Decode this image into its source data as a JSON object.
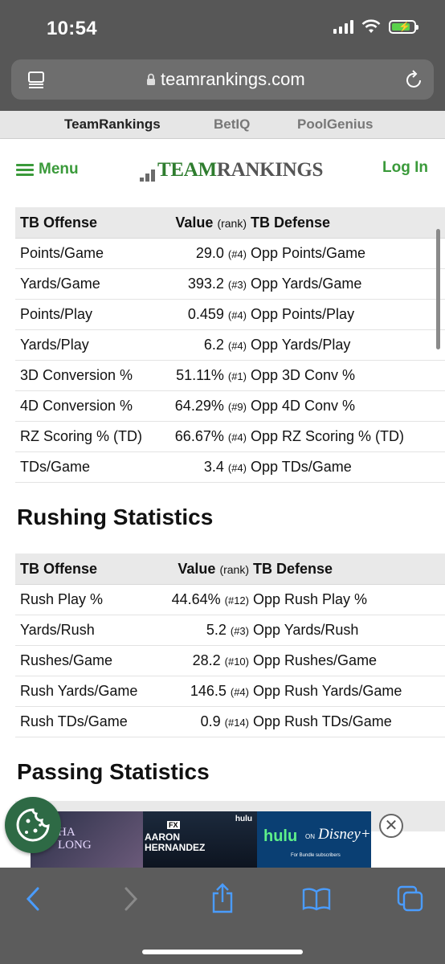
{
  "status": {
    "time": "10:54"
  },
  "browser": {
    "url": "teamrankings.com"
  },
  "site_nav": [
    "TeamRankings",
    "BetIQ",
    "PoolGenius"
  ],
  "header": {
    "menu_label": "Menu",
    "logo_part1": "TEAM",
    "logo_part2": "RANKINGS",
    "login_label": "Log In"
  },
  "offense_table": {
    "headers": {
      "col1": "TB Offense",
      "col2": "Value",
      "col2_suffix": "(rank)",
      "col3": "TB Defense"
    },
    "rows": [
      {
        "stat": "Points/Game",
        "value": "29.0",
        "rank": "(#4)",
        "opp": "Opp Points/Game",
        "extra": ""
      },
      {
        "stat": "Yards/Game",
        "value": "393.2",
        "rank": "(#3)",
        "opp": "Opp Yards/Game",
        "extra": ""
      },
      {
        "stat": "Points/Play",
        "value": "0.459",
        "rank": "(#4)",
        "opp": "Opp Points/Play",
        "extra": ""
      },
      {
        "stat": "Yards/Play",
        "value": "6.2",
        "rank": "(#4)",
        "opp": "Opp Yards/Play",
        "extra": ""
      },
      {
        "stat": "3D Conversion %",
        "value": "51.11%",
        "rank": "(#1)",
        "opp": "Opp 3D Conv %",
        "extra": ""
      },
      {
        "stat": "4D Conversion %",
        "value": "64.29%",
        "rank": "(#9)",
        "opp": "Opp 4D Conv %",
        "extra": ""
      },
      {
        "stat": "RZ Scoring % (TD)",
        "value": "66.67%",
        "rank": "(#4)",
        "opp": "Opp RZ Scoring % (TD)",
        "extra": ""
      },
      {
        "stat": "TDs/Game",
        "value": "3.4",
        "rank": "(#4)",
        "opp": "Opp TDs/Game",
        "extra": ""
      }
    ]
  },
  "rushing": {
    "title": "Rushing Statistics",
    "headers": {
      "col1": "TB Offense",
      "col2": "Value",
      "col2_suffix": "(rank)",
      "col3": "TB Defense"
    },
    "rows": [
      {
        "stat": "Rush Play %",
        "value": "44.64%",
        "rank": "(#12)",
        "opp": "Opp Rush Play %"
      },
      {
        "stat": "Yards/Rush",
        "value": "5.2",
        "rank": "(#3)",
        "opp": "Opp Yards/Rush"
      },
      {
        "stat": "Rushes/Game",
        "value": "28.2",
        "rank": "(#10)",
        "opp": "Opp Rushes/Game"
      },
      {
        "stat": "Rush Yards/Game",
        "value": "146.5",
        "rank": "(#4)",
        "opp": "Opp Rush Yards/Game"
      },
      {
        "stat": "Rush TDs/Game",
        "value": "0.9",
        "rank": "(#14)",
        "opp": "Opp Rush TDs/Game"
      }
    ]
  },
  "passing": {
    "title": "Passing Statistics"
  },
  "ad": {
    "panel1_text": "HA\nLONG",
    "panel2_brand": "FX",
    "panel2_title": "AARON\nHERNANDEZ",
    "panel2_network": "hulu",
    "panel3_text1": "hulu",
    "panel3_text2": "ON",
    "panel3_text3": "Disney+",
    "panel3_small": "For Bundle subscribers",
    "close_label": "✕"
  },
  "colors": {
    "brand_green": "#3a9a3a",
    "logo_green": "#2f7d2f",
    "chrome_gray": "#575757"
  }
}
